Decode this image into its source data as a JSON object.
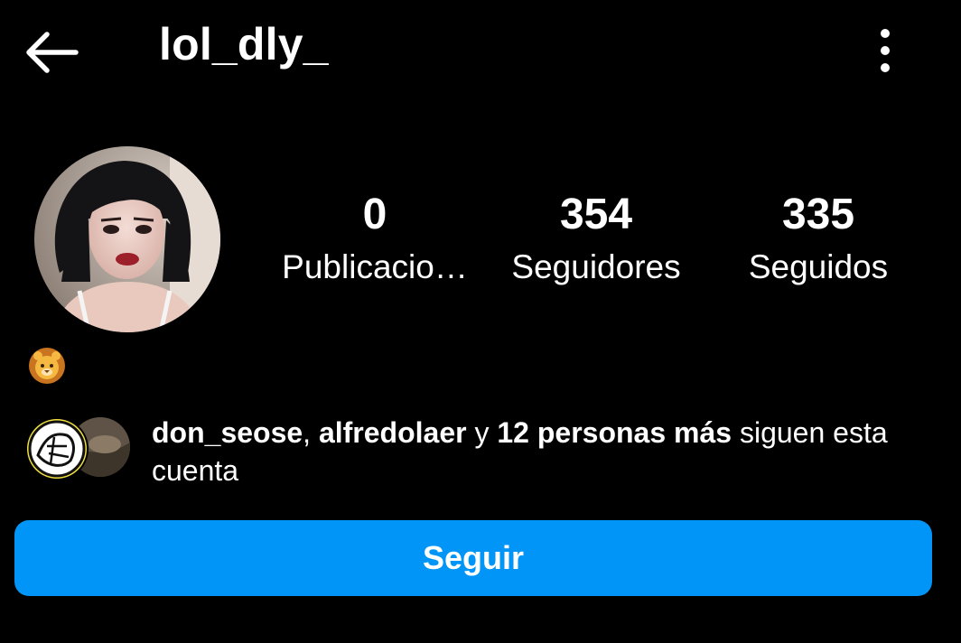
{
  "header": {
    "username": "lol_dly_",
    "back_icon": "arrow-left-icon",
    "more_icon": "more-vertical-icon"
  },
  "profile": {
    "avatar": "profile-photo",
    "stats": [
      {
        "value": "0",
        "label": "Publicacio…"
      },
      {
        "value": "354",
        "label": "Seguidores"
      },
      {
        "value": "335",
        "label": "Seguidos"
      }
    ],
    "bio_emoji": "lion-face-emoji"
  },
  "mutual": {
    "user1": "don_seose",
    "sep1": ", ",
    "user2": "alfredolaer",
    "conj": " y ",
    "others": "12 personas más",
    "suffix": " siguen esta cuenta"
  },
  "actions": {
    "follow_label": "Seguir"
  },
  "colors": {
    "background": "#000000",
    "text": "#ffffff",
    "follow_button": "#0095f6"
  }
}
